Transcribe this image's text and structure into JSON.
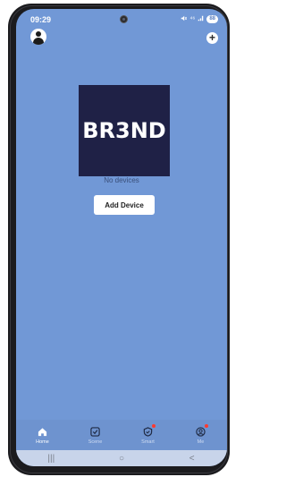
{
  "status_bar": {
    "time": "09:29",
    "signal_text": "⁴⁶",
    "battery": "88"
  },
  "center": {
    "logo_text": "BR3ND",
    "empty_text": "No devices",
    "add_button": "Add Device"
  },
  "tabs": [
    {
      "label": "Home",
      "icon": "home-icon",
      "active": true
    },
    {
      "label": "Scene",
      "icon": "scene-icon",
      "active": false
    },
    {
      "label": "Smart",
      "icon": "smart-icon",
      "active": false,
      "badge": true
    },
    {
      "label": "Me",
      "icon": "me-icon",
      "active": false,
      "badge": true
    }
  ],
  "nav": {
    "recents": "|||",
    "home": "○",
    "back": "<"
  },
  "colors": {
    "background": "#7198d6",
    "logo_bg": "#1f2146",
    "badge": "#ff3a2f"
  }
}
